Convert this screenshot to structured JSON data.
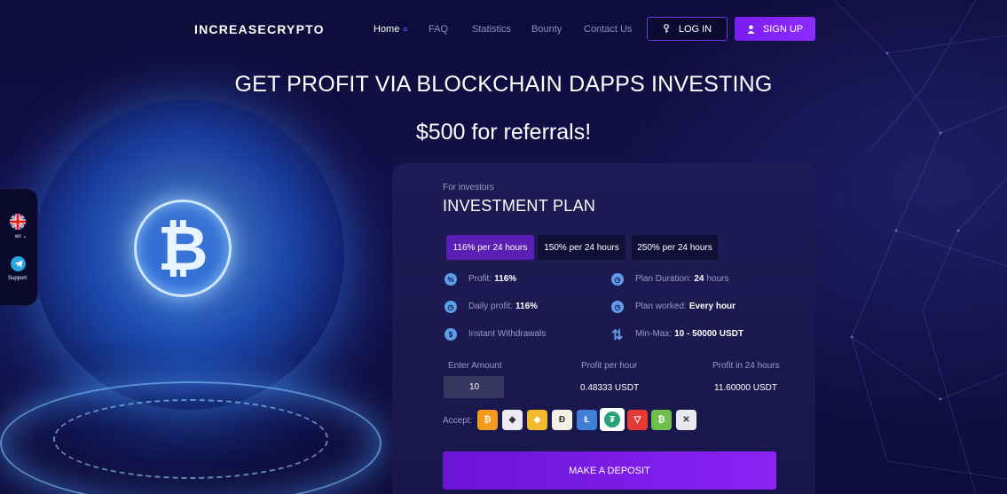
{
  "brand": "INCREASECRYPTO",
  "nav": [
    {
      "label": "Home",
      "active": true
    },
    {
      "label": "FAQ"
    },
    {
      "label": "Statistics"
    },
    {
      "label": "Bounty"
    },
    {
      "label": "Contact Us"
    }
  ],
  "auth": {
    "login": "LOG IN",
    "signup": "SIGN UP",
    "login_icon": "key-icon",
    "signup_icon": "user-icon"
  },
  "hero": {
    "title": "GET PROFIT VIA BLOCKCHAIN DAPPS INVESTING",
    "subtitle": "$500 for referrals!"
  },
  "side": {
    "lang": "en",
    "support": "Support",
    "flag_icon": "uk-flag-icon",
    "support_icon": "telegram-icon"
  },
  "card": {
    "eyebrow": "For investors",
    "title": "INVESTMENT PLAN",
    "tabs": [
      "116% per 24 hours",
      "150% per 24 hours",
      "250% per 24 hours"
    ],
    "active_tab": 0,
    "features": {
      "profit_label": "Profit:",
      "profit_value": "116%",
      "duration_label": "Plan Duration:",
      "duration_value": "24",
      "duration_unit": "hours",
      "daily_label": "Daily profit:",
      "daily_value": "116%",
      "worked_label": "Plan worked:",
      "worked_value": "Every hour",
      "withdrawals_label": "Instant Withdrawals",
      "minmax_label": "Min-Max:",
      "minmax_value": "10 - 50000 USDT"
    },
    "calc": {
      "amount_label": "Enter Amount",
      "amount_value": "10",
      "hour_label": "Profit per hour",
      "hour_value": "0.48333 USDT",
      "day_label": "Profit in 24 hours",
      "day_value": "11.60000 USDT"
    },
    "accept_label": "Accept:",
    "coins": [
      {
        "name": "bitcoin-icon",
        "glyph": "₿",
        "color": "#f39a1f"
      },
      {
        "name": "ethereum-icon",
        "glyph": "◆",
        "color": "#ecebf2"
      },
      {
        "name": "binance-icon",
        "glyph": "◈",
        "color": "#f3ba2f"
      },
      {
        "name": "dogecoin-icon",
        "glyph": "Ð",
        "color": "#f5f0e6"
      },
      {
        "name": "litecoin-icon",
        "glyph": "Ł",
        "color": "#3f7fd8"
      },
      {
        "name": "tether-icon",
        "glyph": "₮",
        "color": "#ffffff",
        "selected": true
      },
      {
        "name": "tron-icon",
        "glyph": "▽",
        "color": "#e53935"
      },
      {
        "name": "bitcoin-cash-icon",
        "glyph": "₿",
        "color": "#6fc04a"
      },
      {
        "name": "ripple-icon",
        "glyph": "✕",
        "color": "#e8e8ee"
      }
    ],
    "deposit": "MAKE A DEPOSIT",
    "colors": {
      "accent": "#7a1cf0",
      "tab_active": "#5b1fb5"
    }
  }
}
